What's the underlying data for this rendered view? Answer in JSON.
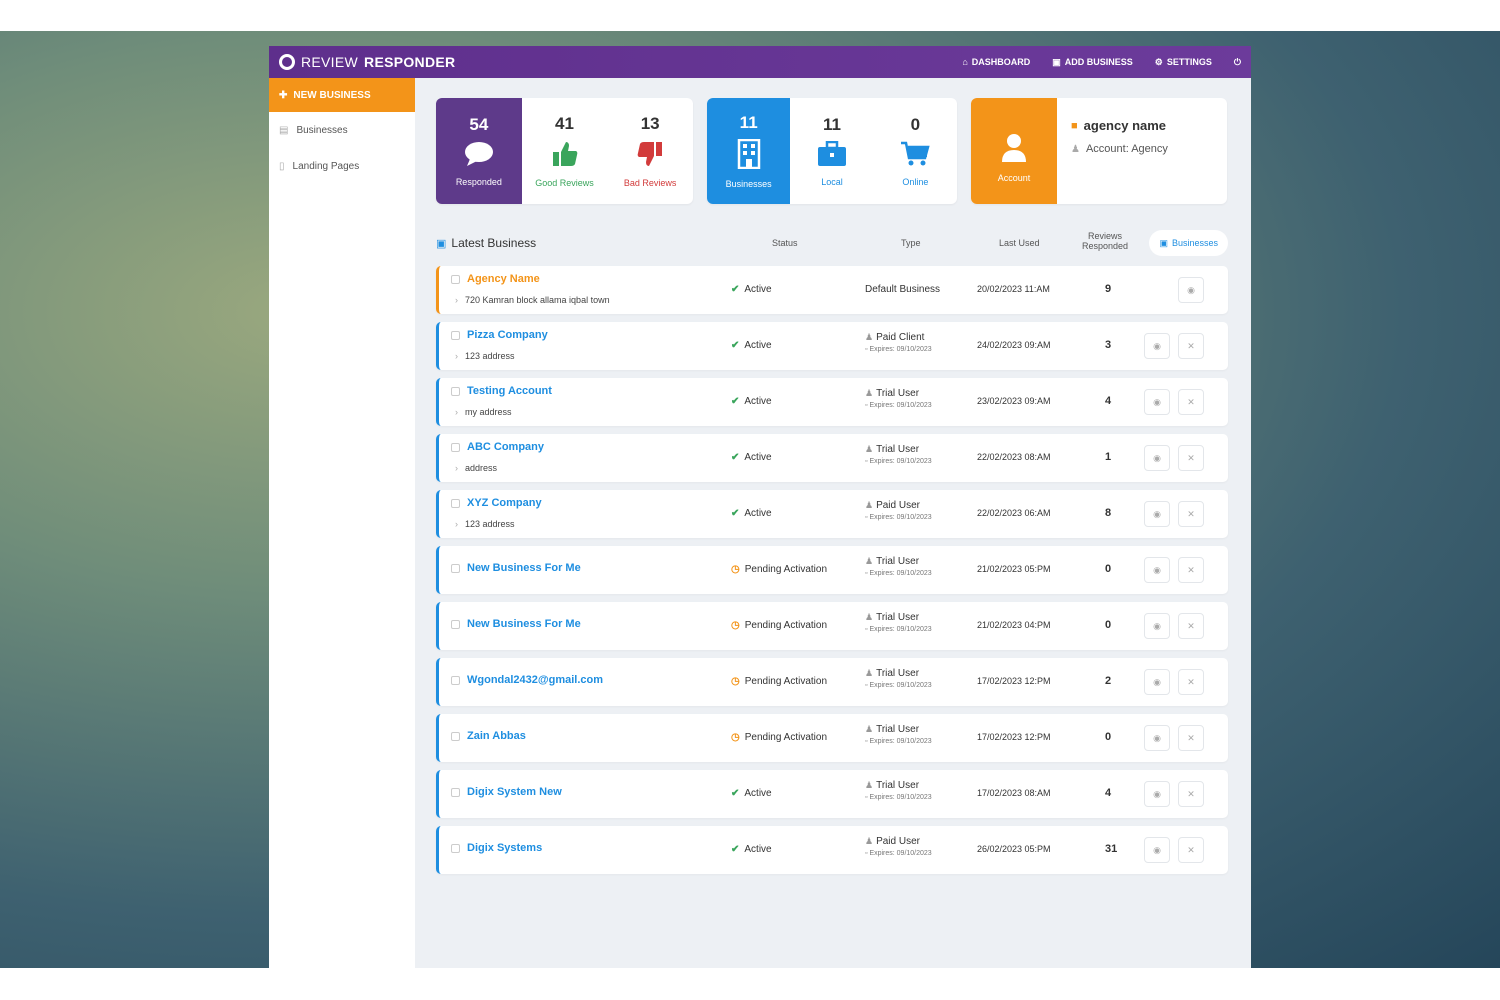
{
  "header": {
    "logo_light": "REVIEW",
    "logo_bold": "RESPONDER",
    "nav": [
      {
        "label": "DASHBOARD",
        "icon": "home-icon",
        "glyph": "⌂"
      },
      {
        "label": "ADD BUSINESS",
        "icon": "briefcase-icon",
        "glyph": "▣"
      },
      {
        "label": "SETTINGS",
        "icon": "gear-icon",
        "glyph": "⚙"
      }
    ],
    "power_glyph": "⏻"
  },
  "sidebar": {
    "new_business": "NEW BUSINESS",
    "items": [
      {
        "label": "Businesses",
        "icon": "building-icon"
      },
      {
        "label": "Landing Pages",
        "icon": "file-icon"
      }
    ]
  },
  "stats": {
    "responded": {
      "value": "54",
      "label": "Responded",
      "icon": "comment-icon"
    },
    "good": {
      "value": "41",
      "label": "Good Reviews",
      "icon": "thumbs-up-icon"
    },
    "bad": {
      "value": "13",
      "label": "Bad Reviews",
      "icon": "thumbs-down-icon"
    },
    "businesses": {
      "value": "11",
      "label": "Businesses",
      "icon": "building-icon"
    },
    "local": {
      "value": "11",
      "label": "Local",
      "icon": "briefcase-icon"
    },
    "online": {
      "value": "0",
      "label": "Online",
      "icon": "cart-icon"
    }
  },
  "account": {
    "label": "Account",
    "name": "agency name",
    "type": "Account: Agency"
  },
  "list": {
    "title": "Latest Business",
    "col_status": "Status",
    "col_type": "Type",
    "col_last_used": "Last Used",
    "col_reviews_1": "Reviews",
    "col_reviews_2": "Responded",
    "filter": "Businesses",
    "rows": [
      {
        "name": "Agency Name",
        "address": "720 Kamran block allama iqbal town",
        "status": "Active",
        "type": "Default Business",
        "expires": "",
        "last_used": "20/02/2023 11:AM",
        "count": "9"
      },
      {
        "name": "Pizza Company",
        "address": "123 address",
        "status": "Active",
        "type": "Paid Client",
        "expires": "Expires: 09/10/2023",
        "last_used": "24/02/2023 09:AM",
        "count": "3"
      },
      {
        "name": "Testing Account",
        "address": "my address",
        "status": "Active",
        "type": "Trial User",
        "expires": "Expires: 09/10/2023",
        "last_used": "23/02/2023 09:AM",
        "count": "4"
      },
      {
        "name": "ABC Company",
        "address": "address",
        "status": "Active",
        "type": "Trial User",
        "expires": "Expires: 09/10/2023",
        "last_used": "22/02/2023 08:AM",
        "count": "1"
      },
      {
        "name": "XYZ Company",
        "address": "123 address",
        "status": "Active",
        "type": "Paid User",
        "expires": "Expires: 09/10/2023",
        "last_used": "22/02/2023 06:AM",
        "count": "8"
      },
      {
        "name": "New Business For Me",
        "address": "",
        "status": "Pending Activation",
        "type": "Trial User",
        "expires": "Expires: 09/10/2023",
        "last_used": "21/02/2023 05:PM",
        "count": "0"
      },
      {
        "name": "New Business For Me",
        "address": "",
        "status": "Pending Activation",
        "type": "Trial User",
        "expires": "Expires: 09/10/2023",
        "last_used": "21/02/2023 04:PM",
        "count": "0"
      },
      {
        "name": "Wgondal2432@gmail.com",
        "address": "",
        "status": "Pending Activation",
        "type": "Trial User",
        "expires": "Expires: 09/10/2023",
        "last_used": "17/02/2023 12:PM",
        "count": "2"
      },
      {
        "name": "Zain Abbas",
        "address": "",
        "status": "Pending Activation",
        "type": "Trial User",
        "expires": "Expires: 09/10/2023",
        "last_used": "17/02/2023 12:PM",
        "count": "0"
      },
      {
        "name": "Digix System New",
        "address": "",
        "status": "Active",
        "type": "Trial User",
        "expires": "Expires: 09/10/2023",
        "last_used": "17/02/2023 08:AM",
        "count": "4"
      },
      {
        "name": "Digix Systems",
        "address": "",
        "status": "Active",
        "type": "Paid User",
        "expires": "Expires: 09/10/2023",
        "last_used": "26/02/2023 05:PM",
        "count": "31"
      }
    ]
  },
  "colors": {
    "brand_purple": "#5e3a8a",
    "accent_orange": "#f39419",
    "accent_blue": "#1e8ee0",
    "good_green": "#3aa55c",
    "bad_red": "#d23b3b"
  }
}
